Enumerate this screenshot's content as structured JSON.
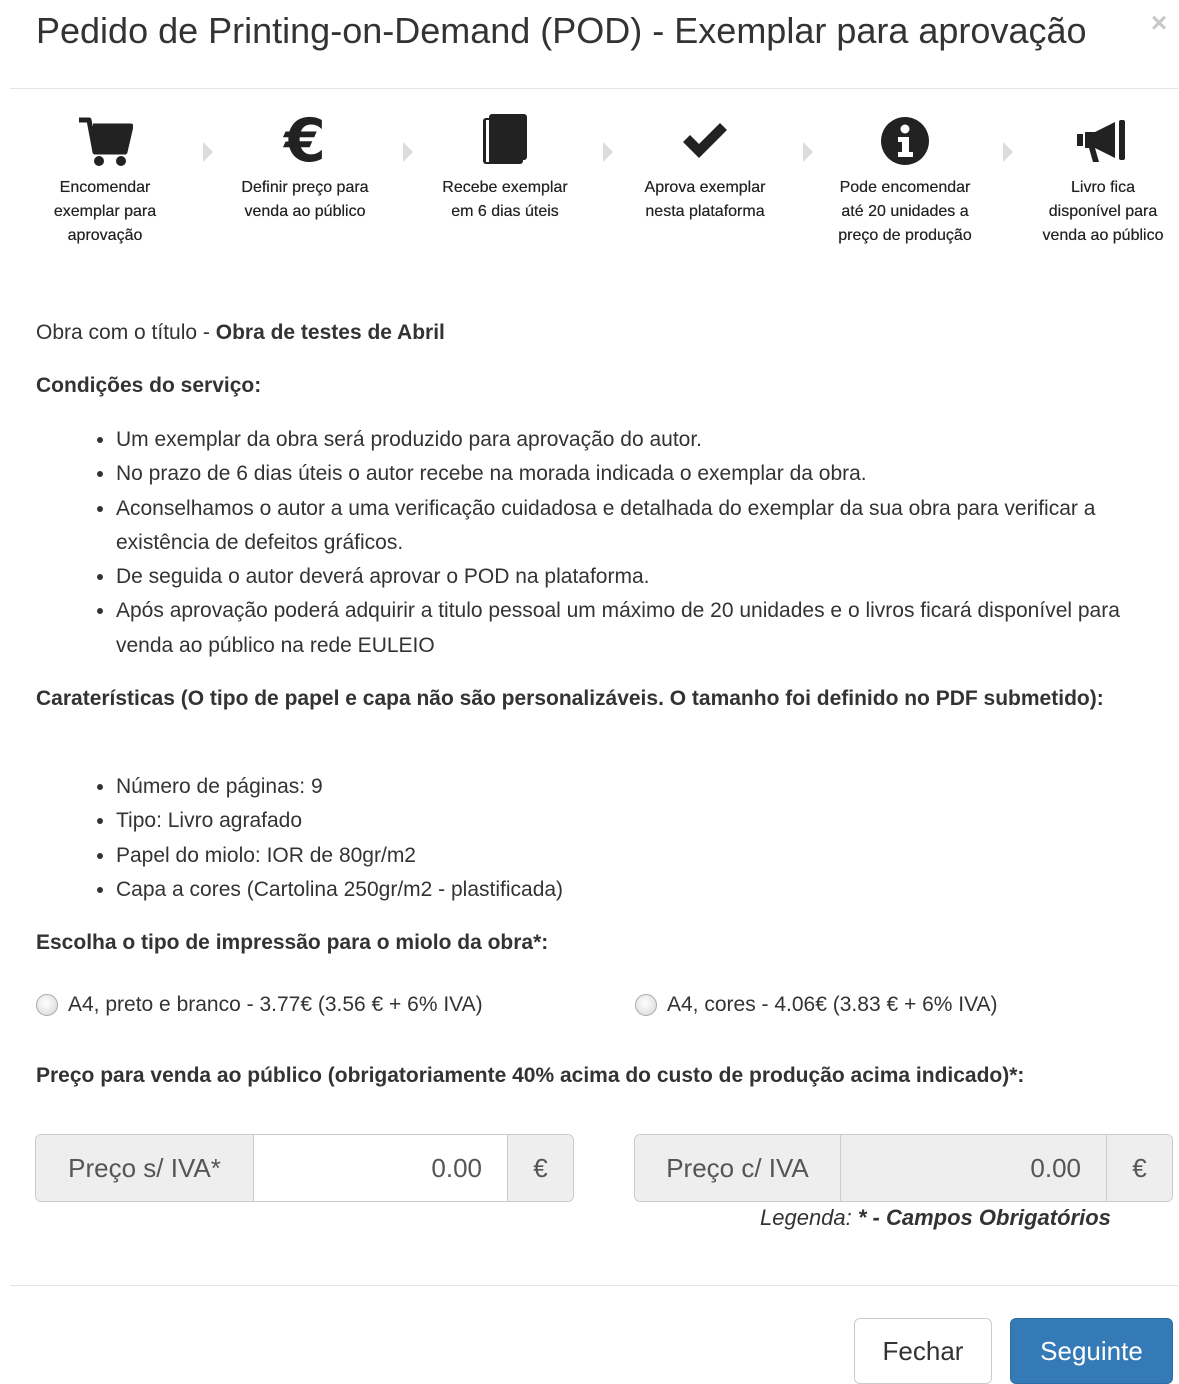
{
  "modal": {
    "title": "Pedido de Printing-on-Demand (POD) - Exemplar para aprovação",
    "close_label": "×"
  },
  "steps": [
    {
      "icon": "cart-icon",
      "label": "Encomendar exemplar para aprovação"
    },
    {
      "icon": "euro-icon",
      "label": "Definir preço para venda ao público"
    },
    {
      "icon": "book-icon",
      "label": "Recebe exemplar em 6 dias úteis"
    },
    {
      "icon": "check-icon",
      "label": "Aprova exemplar nesta plataforma"
    },
    {
      "icon": "info-icon",
      "label": "Pode encomendar até 20 unidades a preço de produção"
    },
    {
      "icon": "bullhorn-icon",
      "label": "Livro fica disponível para venda ao público"
    }
  ],
  "work": {
    "prefix": "Obra com o título - ",
    "title": "Obra de testes de Abril"
  },
  "conditions": {
    "heading": "Condições do serviço:",
    "items": [
      "Um exemplar da obra será produzido para aprovação do autor.",
      "No prazo de 6 dias úteis o autor recebe na morada indicada o exemplar da obra.",
      "Aconselhamos o autor a uma verificação cuidadosa e detalhada do exemplar da sua obra para verificar a existência de defeitos gráficos.",
      "De seguida o autor deverá aprovar o POD na plataforma.",
      "Após aprovação poderá adquirir a titulo pessoal um máximo de 20 unidades e o livros ficará disponível para venda ao público na rede EULEIO"
    ]
  },
  "features": {
    "heading": "Caraterísticas (O tipo de papel e capa não são personalizáveis. O tamanho foi definido no PDF submetido):",
    "items": [
      "Número de páginas: 9",
      "Tipo: Livro agrafado",
      "Papel do miolo: IOR de 80gr/m2",
      "Capa a cores (Cartolina 250gr/m2 - plastificada)"
    ]
  },
  "print_type": {
    "heading": "Escolha o tipo de impressão para o miolo da obra*:",
    "options": [
      {
        "label": "A4, preto e branco - 3.77€ (3.56 € + 6% IVA)",
        "selected": false
      },
      {
        "label": "A4, cores - 4.06€ (3.83 € + 6% IVA)",
        "selected": false
      }
    ]
  },
  "price": {
    "heading": "Preço para venda ao público (obrigatoriamente 40% acima do custo de produção acima indicado)*:",
    "without_vat": {
      "label": "Preço s/ IVA*",
      "value": "0.00",
      "currency": "€"
    },
    "with_vat": {
      "label": "Preço c/ IVA",
      "value": "0.00",
      "currency": "€"
    }
  },
  "legend": {
    "prefix": "Legenda: ",
    "text": "* - Campos Obrigatórios"
  },
  "footer": {
    "close_label": "Fechar",
    "next_label": "Seguinte"
  },
  "colors": {
    "primary": "#337ab7",
    "addon_bg": "#eeeeee",
    "text": "#333333"
  }
}
